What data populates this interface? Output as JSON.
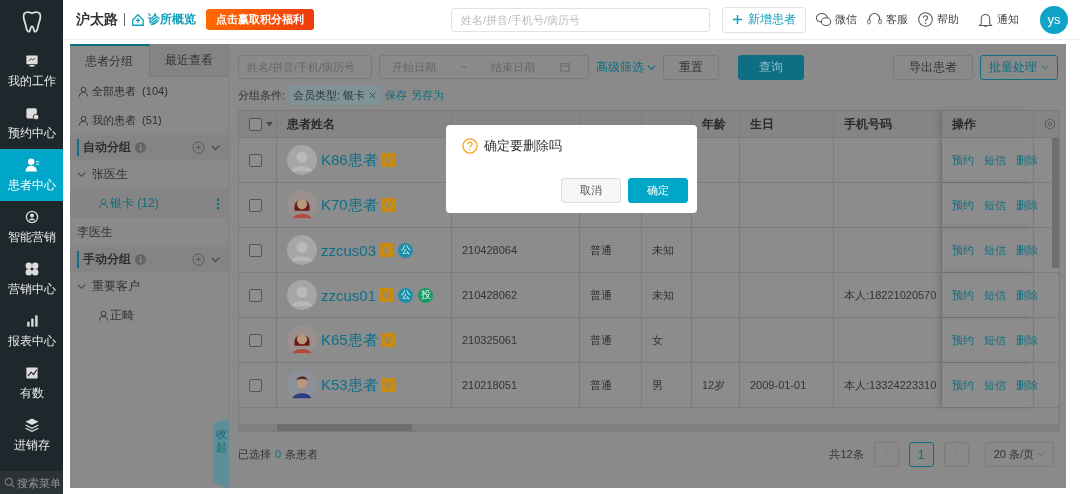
{
  "nav": {
    "items": [
      {
        "label": "我的工作",
        "selected": false
      },
      {
        "label": "预约中心",
        "selected": false
      },
      {
        "label": "患者中心",
        "selected": true
      },
      {
        "label": "智能营销",
        "selected": false
      },
      {
        "label": "营销中心",
        "selected": false
      },
      {
        "label": "报表中心",
        "selected": false
      },
      {
        "label": "有数",
        "selected": false
      },
      {
        "label": "进销存",
        "selected": false
      }
    ],
    "search": {
      "placeholder": "搜索菜单"
    }
  },
  "header": {
    "clinic": "沪太路",
    "overview": "诊所概览",
    "banner": "点击赢取积分福利",
    "search": {
      "placeholder": "姓名/拼音/手机号/病历号"
    },
    "add_button": "新增患者",
    "tools": [
      {
        "label": "微信"
      },
      {
        "label": "客服"
      },
      {
        "label": "帮助"
      },
      {
        "label": "通知"
      }
    ],
    "avatar": "ys"
  },
  "left_panel": {
    "tabs": [
      {
        "label": "患者分组",
        "selected": true
      },
      {
        "label": "最近查看",
        "selected": false
      }
    ],
    "groups": [
      {
        "label": "全部患者",
        "count": "(104)"
      },
      {
        "label": "我的患者",
        "count": "(51)"
      }
    ],
    "sections": [
      {
        "title": "自动分组",
        "children": [
          {
            "label": "张医生",
            "expanded": true,
            "children": [
              {
                "label": "银卡",
                "count": "(12)",
                "selected": true
              }
            ]
          },
          {
            "label": "李医生",
            "expanded": false
          }
        ]
      },
      {
        "title": "手动分组",
        "children": [
          {
            "label": "重要客户",
            "expanded": true,
            "children": [
              {
                "label": "正畸",
                "selected": false
              }
            ]
          }
        ]
      }
    ],
    "collapse": "收起"
  },
  "filters": {
    "search": {
      "placeholder": "姓名/拼音/手机/病历号"
    },
    "start": {
      "placeholder": "开始日期"
    },
    "separator": "~",
    "end": {
      "placeholder": "结束日期"
    },
    "advanced": "高级筛选",
    "reset": "重置",
    "query": "查询",
    "export": "导出患者",
    "batch": "批量处理",
    "condition_label": "分组条件:",
    "condition_tag": "会员类型: 银卡",
    "save": "保存",
    "save_as": "另存为"
  },
  "table": {
    "select_all_checked": false,
    "columns": [
      "患者姓名",
      "",
      "",
      "",
      "年龄",
      "生日",
      "手机号码",
      "操作"
    ],
    "rows": [
      {
        "name": "K86患者",
        "kind": "placeholder",
        "tags": [],
        "column_3": "",
        "column_4": "",
        "column_5": "",
        "age": "",
        "birthday": "",
        "phone": "",
        "checked": false,
        "actions": [
          "预约",
          "短信",
          "删除"
        ]
      },
      {
        "name": "K70患者",
        "kind": "female",
        "tags": [],
        "column_3": "",
        "column_4": "",
        "column_5": "",
        "age": "",
        "birthday": "",
        "phone": "",
        "checked": false,
        "actions": [
          "预约",
          "短信",
          "删除"
        ]
      },
      {
        "name": "zzcus03",
        "kind": "placeholder",
        "tags": [
          {
            "label": "公",
            "color": "#1a8fa8"
          }
        ],
        "column_3": "210428064",
        "column_4": "普通",
        "column_5": "未知",
        "age": "",
        "birthday": "",
        "phone": "",
        "checked": false,
        "actions": [
          "预约",
          "短信",
          "删除"
        ]
      },
      {
        "name": "zzcus01",
        "kind": "placeholder",
        "tags": [
          {
            "label": "公",
            "color": "#1a8fa8"
          },
          {
            "label": "投",
            "color": "#169a62"
          }
        ],
        "column_3": "210428062",
        "column_4": "普通",
        "column_5": "未知",
        "age": "",
        "birthday": "",
        "phone": "本人:18221020570",
        "checked": false,
        "actions": [
          "预约",
          "短信",
          "删除"
        ]
      },
      {
        "name": "K65患者",
        "kind": "female",
        "tags": [],
        "column_3": "210325061",
        "column_4": "普通",
        "column_5": "女",
        "age": "",
        "birthday": "",
        "phone": "",
        "checked": false,
        "actions": [
          "预约",
          "短信",
          "删除"
        ]
      },
      {
        "name": "K53患者",
        "kind": "male",
        "tags": [],
        "column_3": "210218051",
        "column_4": "普通",
        "column_5": "男",
        "age": "12岁",
        "birthday": "2009-01-01",
        "phone": "本人:13324223310",
        "checked": false,
        "actions": [
          "预约",
          "短信",
          "删除"
        ]
      }
    ]
  },
  "footer": {
    "selected_prefix": "已选择",
    "selected_count": "0",
    "selected_suffix": "条患者",
    "total": "共12条",
    "pages": [
      {
        "label": "1",
        "selected": true
      }
    ],
    "page_size": "20 条/页"
  },
  "dialog": {
    "message": "确定要删除吗",
    "cancel": "取消",
    "confirm": "确定"
  }
}
